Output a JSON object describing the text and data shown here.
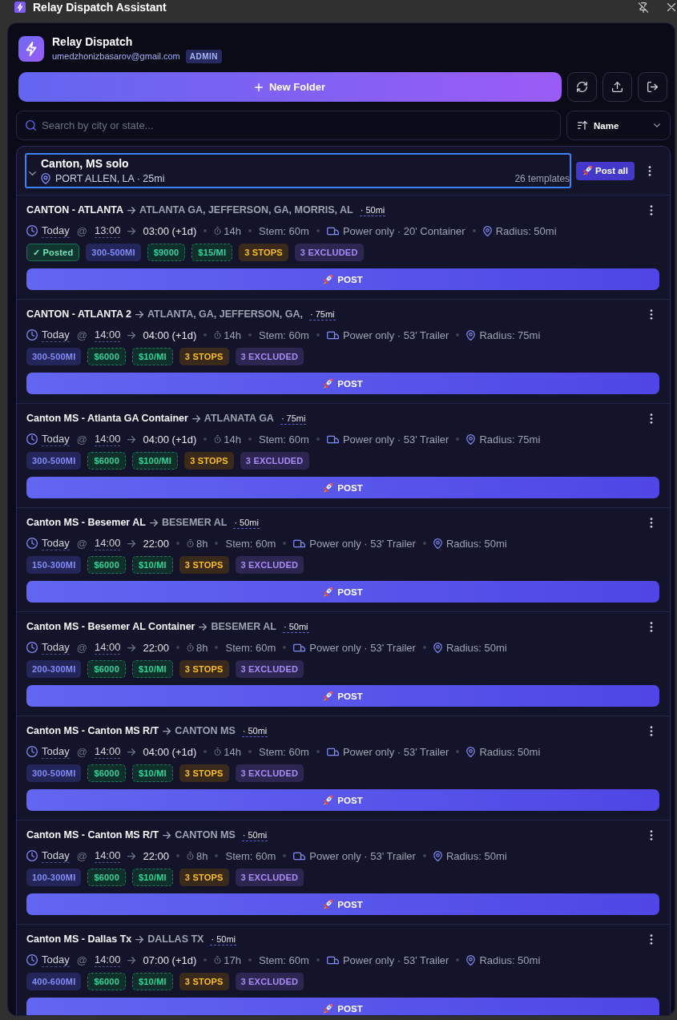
{
  "window": {
    "title": "Relay Dispatch Assistant"
  },
  "account": {
    "name": "Relay Dispatch",
    "email": "umedzhonizbasarov@gmail.com",
    "role": "ADMIN"
  },
  "actions": {
    "new_folder": "New Folder"
  },
  "search": {
    "placeholder": "Search by city or state..."
  },
  "sort": {
    "value": "Name"
  },
  "folder": {
    "title": "Canton, MS solo",
    "location": "PORT ALLEN, LA · 25mi",
    "count": "26 templates",
    "expanded": true,
    "focused": true,
    "post_all": "Post all",
    "templates": [
      {
        "name": "CANTON - ATLANTA",
        "destination": "ATLANTA GA, JEFFERSON, GA, MORRIS, AL",
        "distance": "· 50mi",
        "day": "Today",
        "at": "@",
        "start": "13:00",
        "end": "03:00 (+1d)",
        "duration": "14h",
        "stem": "Stem: 60m",
        "equipment": "Power only · 20' Container",
        "radius": "Radius: 50mi",
        "tags": [
          {
            "kind": "status",
            "text": "✓ Posted"
          },
          {
            "kind": "range",
            "text": "300-500MI"
          },
          {
            "kind": "pay",
            "text": "$9000"
          },
          {
            "kind": "pay",
            "text": "$15/MI"
          },
          {
            "kind": "stops",
            "text": "3 STOPS"
          },
          {
            "kind": "excluded",
            "text": "3 EXCLUDED"
          }
        ],
        "post": "POST"
      },
      {
        "name": "CANTON - ATLANTA 2",
        "destination": "ATLANTA, GA, JEFFERSON, GA,",
        "distance": "· 75mi",
        "day": "Today",
        "at": "@",
        "start": "14:00",
        "end": "04:00 (+1d)",
        "duration": "14h",
        "stem": "Stem: 60m",
        "equipment": "Power only · 53' Trailer",
        "radius": "Radius: 75mi",
        "tags": [
          {
            "kind": "range",
            "text": "300-500MI"
          },
          {
            "kind": "pay",
            "text": "$6000"
          },
          {
            "kind": "pay",
            "text": "$10/MI"
          },
          {
            "kind": "stops",
            "text": "3 STOPS"
          },
          {
            "kind": "excluded",
            "text": "3 EXCLUDED"
          }
        ],
        "post": "POST"
      },
      {
        "name": "Canton MS - Atlanta GA Container",
        "destination": "ATLANATA GA",
        "distance": "· 75mi",
        "day": "Today",
        "at": "@",
        "start": "14:00",
        "end": "04:00 (+1d)",
        "duration": "14h",
        "stem": "Stem: 60m",
        "equipment": "Power only · 53' Trailer",
        "radius": "Radius: 75mi",
        "tags": [
          {
            "kind": "range",
            "text": "300-500MI"
          },
          {
            "kind": "pay",
            "text": "$6000"
          },
          {
            "kind": "pay",
            "text": "$100/MI"
          },
          {
            "kind": "stops",
            "text": "3 STOPS"
          },
          {
            "kind": "excluded",
            "text": "3 EXCLUDED"
          }
        ],
        "post": "POST"
      },
      {
        "name": "Canton MS - Besemer AL",
        "destination": "BESEMER AL",
        "distance": "· 50mi",
        "day": "Today",
        "at": "@",
        "start": "14:00",
        "end": "22:00",
        "duration": "8h",
        "stem": "Stem: 60m",
        "equipment": "Power only · 53' Trailer",
        "radius": "Radius: 50mi",
        "tags": [
          {
            "kind": "range",
            "text": "150-300MI"
          },
          {
            "kind": "pay",
            "text": "$6000"
          },
          {
            "kind": "pay",
            "text": "$10/MI"
          },
          {
            "kind": "stops",
            "text": "3 STOPS"
          },
          {
            "kind": "excluded",
            "text": "3 EXCLUDED"
          }
        ],
        "post": "POST"
      },
      {
        "name": "Canton MS - Besemer AL Container",
        "destination": "BESEMER AL",
        "distance": "· 50mi",
        "day": "Today",
        "at": "@",
        "start": "14:00",
        "end": "22:00",
        "duration": "8h",
        "stem": "Stem: 60m",
        "equipment": "Power only · 53' Trailer",
        "radius": "Radius: 50mi",
        "tags": [
          {
            "kind": "range",
            "text": "200-300MI"
          },
          {
            "kind": "pay",
            "text": "$6000"
          },
          {
            "kind": "pay",
            "text": "$10/MI"
          },
          {
            "kind": "stops",
            "text": "3 STOPS"
          },
          {
            "kind": "excluded",
            "text": "3 EXCLUDED"
          }
        ],
        "post": "POST"
      },
      {
        "name": "Canton MS - Canton MS R/T",
        "destination": "CANTON MS",
        "distance": "· 50mi",
        "day": "Today",
        "at": "@",
        "start": "14:00",
        "end": "04:00 (+1d)",
        "duration": "14h",
        "stem": "Stem: 60m",
        "equipment": "Power only · 53' Trailer",
        "radius": "Radius: 50mi",
        "tags": [
          {
            "kind": "range",
            "text": "300-500MI"
          },
          {
            "kind": "pay",
            "text": "$6000"
          },
          {
            "kind": "pay",
            "text": "$10/MI"
          },
          {
            "kind": "stops",
            "text": "3 STOPS"
          },
          {
            "kind": "excluded",
            "text": "3 EXCLUDED"
          }
        ],
        "post": "POST"
      },
      {
        "name": "Canton MS - Canton MS R/T",
        "destination": "CANTON MS",
        "distance": "· 50mi",
        "day": "Today",
        "at": "@",
        "start": "14:00",
        "end": "22:00",
        "duration": "8h",
        "stem": "Stem: 60m",
        "equipment": "Power only · 53' Trailer",
        "radius": "Radius: 50mi",
        "tags": [
          {
            "kind": "range",
            "text": "100-300MI"
          },
          {
            "kind": "pay",
            "text": "$6000"
          },
          {
            "kind": "pay",
            "text": "$10/MI"
          },
          {
            "kind": "stops",
            "text": "3 STOPS"
          },
          {
            "kind": "excluded",
            "text": "3 EXCLUDED"
          }
        ],
        "post": "POST"
      },
      {
        "name": "Canton MS - Dallas Tx",
        "destination": "DALLAS TX",
        "distance": "· 50mi",
        "day": "Today",
        "at": "@",
        "start": "14:00",
        "end": "07:00 (+1d)",
        "duration": "17h",
        "stem": "Stem: 60m",
        "equipment": "Power only · 53' Trailer",
        "radius": "Radius: 50mi",
        "tags": [
          {
            "kind": "range",
            "text": "400-600MI"
          },
          {
            "kind": "pay",
            "text": "$6000"
          },
          {
            "kind": "pay",
            "text": "$10/MI"
          },
          {
            "kind": "stops",
            "text": "3 STOPS"
          },
          {
            "kind": "excluded",
            "text": "3 EXCLUDED"
          }
        ],
        "post": "POST"
      }
    ]
  }
}
